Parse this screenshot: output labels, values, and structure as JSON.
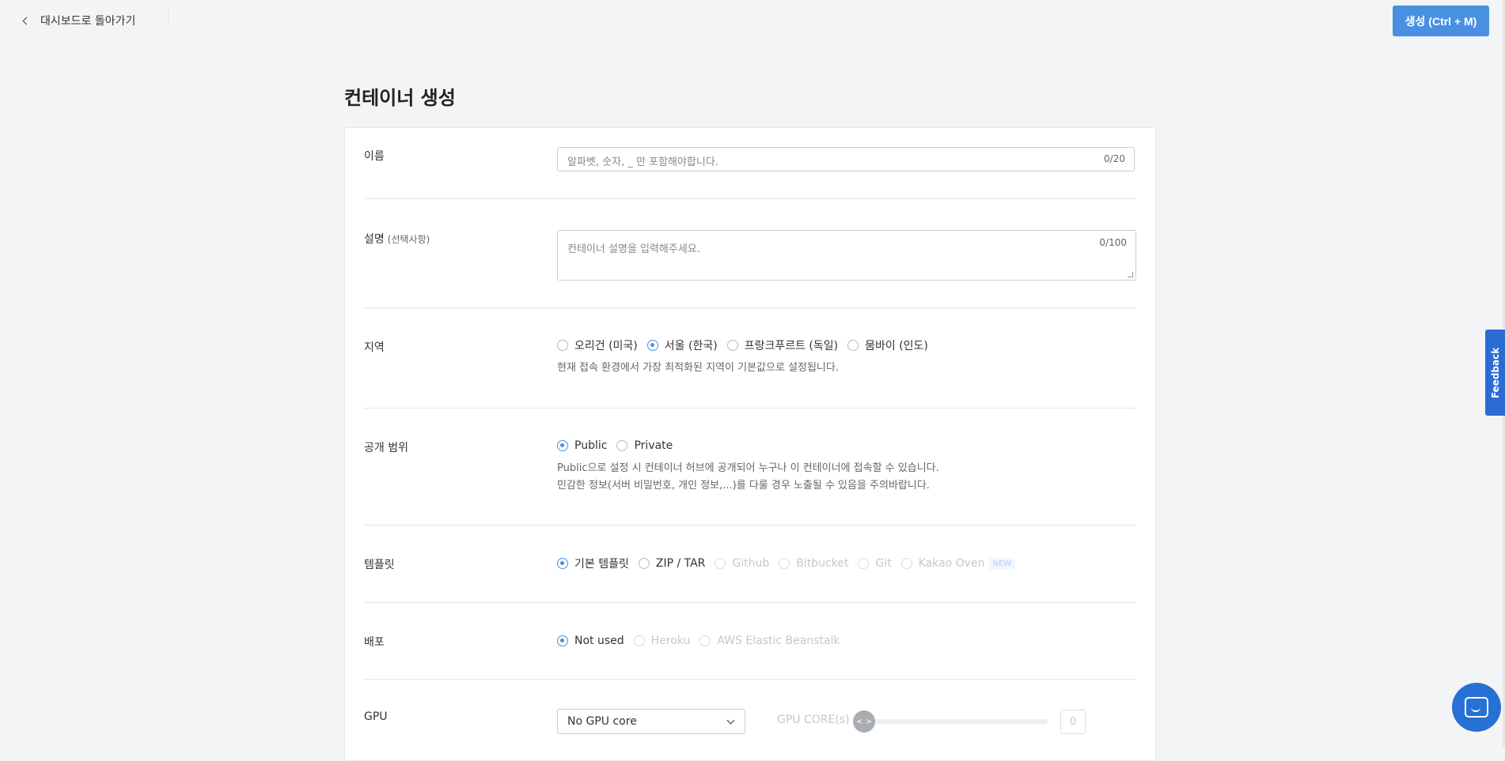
{
  "header": {
    "back_label": "대시보드로 돌아가기",
    "create_button": "생성 (Ctrl + M)"
  },
  "page_title": "컨테이너 생성",
  "form": {
    "name": {
      "label": "이름",
      "placeholder": "알파벳, 숫자, _ 만 포함해야합니다.",
      "counter": "0/20"
    },
    "description": {
      "label": "설명",
      "optional": "(선택사항)",
      "placeholder": "컨테이너 설명을 입력해주세요.",
      "counter": "0/100"
    },
    "region": {
      "label": "지역",
      "options": [
        "오리건 (미국)",
        "서울 (한국)",
        "프랑크푸르트 (독일)",
        "뭄바이 (인도)"
      ],
      "selected": "서울 (한국)",
      "help": "현재 접속 환경에서 가장 최적화된 지역이 기본값으로 설정됩니다."
    },
    "visibility": {
      "label": "공개 범위",
      "options": [
        "Public",
        "Private"
      ],
      "selected": "Public",
      "help_line1": "Public으로 설정 시 컨테이너 허브에 공개되어 누구나 이 컨테이너에 접속할 수 있습니다.",
      "help_line2": "민감한 정보(서버 비밀번호, 개인 정보,...)를 다룰 경우 노출될 수 있음을 주의바랍니다."
    },
    "template": {
      "label": "템플릿",
      "options": [
        "기본 템플릿",
        "ZIP / TAR",
        "Github",
        "Bitbucket",
        "Git",
        "Kakao Oven"
      ],
      "selected": "기본 템플릿",
      "new_badge": "NEW"
    },
    "deploy": {
      "label": "배포",
      "options": [
        "Not used",
        "Heroku",
        "AWS Elastic Beanstalk"
      ],
      "selected": "Not used"
    },
    "gpu": {
      "label": "GPU",
      "select_value": "No GPU core",
      "cores_label": "GPU CORE(s)",
      "slider_glyph": "< >",
      "cores_value": "0"
    }
  },
  "widgets": {
    "feedback_label": "Feedback"
  },
  "colors": {
    "accent": "#4a90e2",
    "feedback": "#2b6bd4",
    "chat": "#2770d4"
  }
}
